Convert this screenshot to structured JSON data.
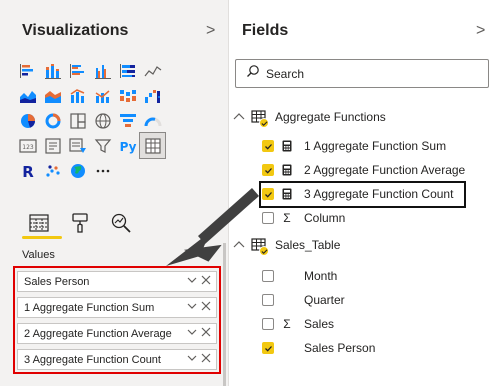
{
  "visualizations": {
    "title": "Visualizations",
    "collapse_glyph": ">",
    "grid": [
      [
        "stacked-bar-icon",
        "stacked-column-icon",
        "clustered-bar-icon",
        "clustered-column-icon",
        "100-stacked-bar-icon",
        "line-chart-icon"
      ],
      [
        "area-chart-icon",
        "stacked-area-icon",
        "line-clustered-column-icon",
        "line-stacked-column-icon",
        "ribbon-chart-icon",
        "waterfall-chart-icon"
      ],
      [
        "pie-chart-icon",
        "donut-chart-icon",
        "treemap-icon",
        "map-icon",
        "funnel-icon",
        "gauge-icon"
      ],
      [
        "card-icon",
        "multi-row-card-icon",
        "kpi-icon",
        "slicer-icon",
        "python-visual-icon",
        "table-icon"
      ],
      [
        "r-visual-icon",
        "scatter-icon",
        "globe-map-icon",
        "more-visuals-icon"
      ]
    ],
    "selected_visual": "table-icon",
    "tabs": [
      "fields-tab-icon",
      "format-tab-icon",
      "analytics-tab-icon"
    ],
    "values_label": "Values",
    "value_fields": [
      "Sales Person",
      "1 Aggregate Function Sum",
      "2 Aggregate Function Average",
      "3 Aggregate Function Count"
    ],
    "accent_color": "#f2c811",
    "highlight_color": "#e00000"
  },
  "fields": {
    "title": "Fields",
    "collapse_glyph": ">",
    "search_placeholder": "Search",
    "tables": [
      {
        "name": "Aggregate Functions",
        "expanded": true,
        "items": [
          {
            "label": "1 Aggregate Function Sum",
            "checked": true,
            "type": "calculator-icon"
          },
          {
            "label": "2 Aggregate Function Average",
            "checked": true,
            "type": "calculator-icon"
          },
          {
            "label": "3 Aggregate Function Count",
            "checked": true,
            "type": "calculator-icon"
          },
          {
            "label": "Column",
            "checked": false,
            "type": "sigma-icon",
            "glyph": "Σ"
          }
        ]
      },
      {
        "name": "Sales_Table",
        "expanded": true,
        "items": [
          {
            "label": "Month",
            "checked": false,
            "type": ""
          },
          {
            "label": "Quarter",
            "checked": false,
            "type": ""
          },
          {
            "label": "Sales",
            "checked": false,
            "type": "sigma-icon",
            "glyph": "Σ"
          },
          {
            "label": "Sales Person",
            "checked": true,
            "type": ""
          }
        ]
      }
    ]
  }
}
